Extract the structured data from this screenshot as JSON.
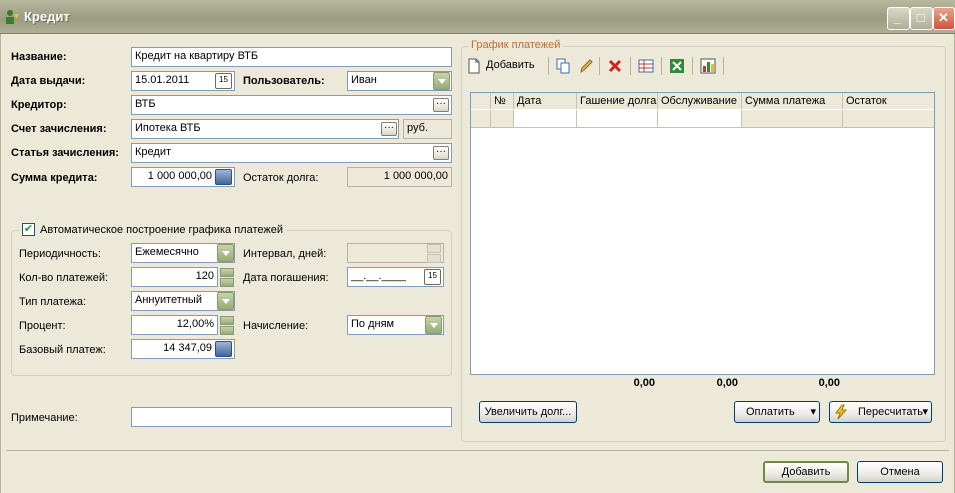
{
  "window": {
    "title": "Кредит"
  },
  "form": {
    "name_label": "Название:",
    "name_value": "Кредит на квартиру ВТБ",
    "date_label": "Дата выдачи:",
    "date_value": "15.01.2011",
    "user_label": "Пользователь:",
    "user_value": "Иван",
    "creditor_label": "Кредитор:",
    "creditor_value": "ВТБ",
    "account_label": "Счет зачисления:",
    "account_value": "Ипотека ВТБ",
    "account_currency": "руб.",
    "article_label": "Статья зачисления:",
    "article_value": "Кредит",
    "amount_label": "Сумма кредита:",
    "amount_value": "1 000 000,00",
    "remaining_label": "Остаток долга:",
    "remaining_value": "1 000 000,00",
    "note_label": "Примечание:",
    "note_value": ""
  },
  "schedule_builder": {
    "checkbox_label": "Автоматическое построение графика платежей",
    "checked": true,
    "periodicity_label": "Периодичность:",
    "periodicity_value": "Ежемесячно",
    "interval_label": "Интервал, дней:",
    "interval_value": "",
    "count_label": "Кол-во платежей:",
    "count_value": "120",
    "repayment_date_label": "Дата погашения:",
    "repayment_date_value": "__.__.____",
    "payment_type_label": "Тип платежа:",
    "payment_type_value": "Аннуитетный",
    "percent_label": "Процент:",
    "percent_value": "12,00%",
    "accrual_label": "Начисление:",
    "accrual_value": "По дням",
    "base_payment_label": "Базовый платеж:",
    "base_payment_value": "14 347,09"
  },
  "schedule": {
    "group_title": "График платежей",
    "toolbar": {
      "add_label": "Добавить",
      "icons": [
        "copy-icon",
        "edit-icon",
        "delete-icon",
        "table-icon",
        "excel-icon",
        "chart-icon"
      ]
    },
    "columns": [
      "№",
      "Дата",
      "Гашение долга",
      "Обслуживание",
      "Сумма платежа",
      "Остаток"
    ],
    "totals": [
      "0,00",
      "0,00",
      "0,00"
    ],
    "increase_debt_button": "Увеличить долг...",
    "pay_button": "Оплатить",
    "recalc_button": "Пересчитать"
  },
  "footer": {
    "add_button": "Добавить",
    "cancel_button": "Отмена"
  },
  "colors": {
    "titlebar": "#a3a38a",
    "window_bg": "#ece9d8",
    "input_border": "#7f9db9",
    "group_title": "#c36b2e"
  }
}
